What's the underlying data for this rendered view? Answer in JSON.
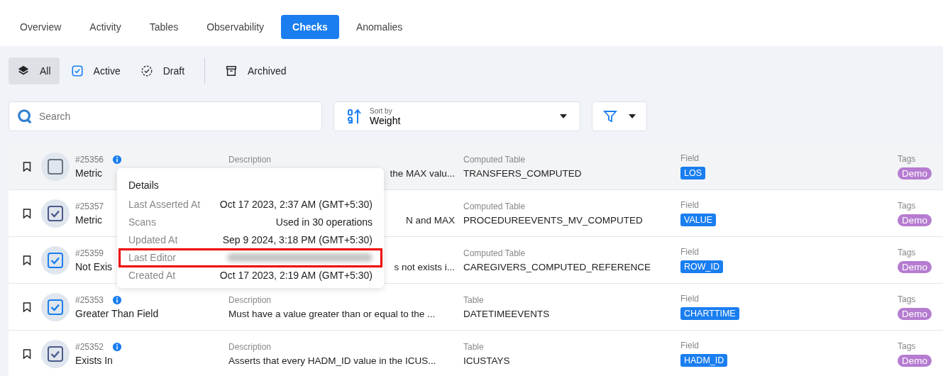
{
  "tabs": [
    {
      "label": "Overview",
      "selected": false
    },
    {
      "label": "Activity",
      "selected": false
    },
    {
      "label": "Tables",
      "selected": false
    },
    {
      "label": "Observability",
      "selected": false
    },
    {
      "label": "Checks",
      "selected": true
    },
    {
      "label": "Anomalies",
      "selected": false
    }
  ],
  "status_filters": [
    {
      "label": "All",
      "kind": "layers",
      "selected": true
    },
    {
      "label": "Active",
      "kind": "active",
      "selected": false
    },
    {
      "label": "Draft",
      "kind": "draft",
      "selected": false
    },
    {
      "label": "Archived",
      "kind": "archive",
      "selected": false
    }
  ],
  "search": {
    "placeholder": "Search"
  },
  "sort": {
    "label": "Sort by",
    "value": "Weight"
  },
  "checks": [
    {
      "id": "#25356",
      "name": "Metric",
      "info": true,
      "checked": false,
      "color": "#6b7280",
      "hovered": true,
      "description_label": "Description",
      "description": "the MAX valu...",
      "table_label": "Computed Table",
      "table": "TRANSFERS_COMPUTED",
      "field_label": "Field",
      "field": "LOS",
      "tags_label": "Tags",
      "tag": "Demo"
    },
    {
      "id": "#25357",
      "name": "Metric",
      "info": false,
      "checked": true,
      "color": "#4b5a8a",
      "hovered": false,
      "description": "N and MAX",
      "table_label": "Computed Table",
      "table": "PROCEDUREEVENTS_MV_COMPUTED",
      "field_label": "Field",
      "field": "VALUE",
      "tags_label": "Tags",
      "tag": "Demo"
    },
    {
      "id": "#25359",
      "name": "Not Exis",
      "info": false,
      "checked": true,
      "color": "#1a7ef0",
      "hovered": false,
      "description": "s not exists i...",
      "table_label": "Computed Table",
      "table": "CAREGIVERS_COMPUTED_REFERENCE",
      "field_label": "Field",
      "field": "ROW_ID",
      "tags_label": "Tags",
      "tag": "Demo"
    },
    {
      "id": "#25353",
      "name": "Greater Than Field",
      "info": true,
      "checked": true,
      "color": "#1a7ef0",
      "hovered": false,
      "description_label": "Description",
      "description": "Must have a value greater than or equal to the ...",
      "table_label": "Table",
      "table": "DATETIMEEVENTS",
      "field_label": "Field",
      "field": "CHARTTIME",
      "tags_label": "Tags",
      "tag": "Demo"
    },
    {
      "id": "#25352",
      "name": "Exists In",
      "info": true,
      "checked": true,
      "color": "#4b5a8a",
      "hovered": false,
      "description_label": "Description",
      "description": "Asserts that every HADM_ID value in the ICUS...",
      "table_label": "Table",
      "table": "ICUSTAYS",
      "field_label": "Field",
      "field": "HADM_ID",
      "tags_label": "Tags",
      "tag": "Demo"
    }
  ],
  "details_popover": {
    "title": "Details",
    "rows": [
      {
        "label": "Last Asserted At",
        "value": "Oct 17 2023, 2:37 AM (GMT+5:30)",
        "redacted": false,
        "highlighted": false
      },
      {
        "label": "Scans",
        "value": "Used in 30 operations",
        "redacted": false,
        "highlighted": false
      },
      {
        "label": "Updated At",
        "value": "Sep 9 2024, 3:18 PM (GMT+5:30)",
        "redacted": false,
        "highlighted": false
      },
      {
        "label": "Last Editor",
        "redacted": true,
        "highlighted": true
      },
      {
        "label": "Created At",
        "value": "Oct 17 2023, 2:19 AM (GMT+5:30)",
        "redacted": false,
        "highlighted": false
      }
    ]
  }
}
